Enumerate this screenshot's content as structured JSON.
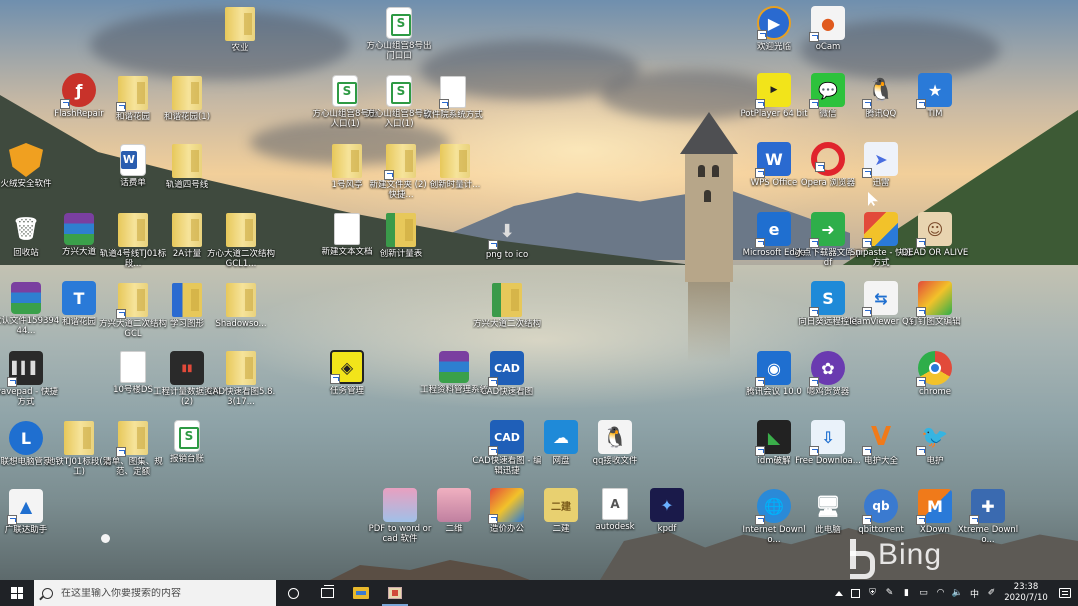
{
  "desktop": {
    "icons": {
      "i01": {
        "label": "农业"
      },
      "i02": {
        "label": "方心山组宫8号出门口口"
      },
      "i03": {
        "label": "欢迎光临"
      },
      "i04": {
        "label": "oCam"
      },
      "i05": {
        "label": "FlashRepair"
      },
      "i06": {
        "label": "和谐花园"
      },
      "i07": {
        "label": "和谐花园(1)"
      },
      "i08": {
        "label": "方心山组宫8号出人口(1)"
      },
      "i09": {
        "label": "方心山组宫8号出入口(1)"
      },
      "i10": {
        "label": "软件院系统方式"
      },
      "i11": {
        "label": "PotPlayer 64 bit"
      },
      "i12": {
        "label": "微信"
      },
      "i13": {
        "label": "腾讯QQ"
      },
      "i14": {
        "label": "TIM"
      },
      "i15": {
        "label": "火绒安全软件"
      },
      "i16": {
        "label": "话费单"
      },
      "i17": {
        "label": "轨道四号线"
      },
      "i18": {
        "label": "1号风亭"
      },
      "i19": {
        "label": "新建文件夹 (2) - 快捷..."
      },
      "i20": {
        "label": "创新时量计..."
      },
      "i21": {
        "label": "WPS Office"
      },
      "i22": {
        "label": "Opera 浏览器"
      },
      "i23": {
        "label": "迅雷"
      },
      "i24": {
        "label": "回收站"
      },
      "i25": {
        "label": "方兴大道"
      },
      "i26": {
        "label": "轨道4号线TJ01标段..."
      },
      "i27": {
        "label": "2A计量"
      },
      "i28": {
        "label": "方心大道二次结构GCL1..."
      },
      "i29": {
        "label": "新建文本文档"
      },
      "i30": {
        "label": "创新计量表"
      },
      "i31": {
        "label": "png to ico"
      },
      "i32": {
        "label": "Microsoft Edge"
      },
      "i33": {
        "label": "冰点下载器文库.pdf"
      },
      "i34": {
        "label": "Snipaste - 快捷方式"
      },
      "i35": {
        "label": "DEAD OR ALIVE"
      },
      "i36": {
        "label": "默认文件15939444..."
      },
      "i37": {
        "label": "和谐花园"
      },
      "i38": {
        "label": "方兴大道二次结构GCL"
      },
      "i39": {
        "label": "学习图形"
      },
      "i40": {
        "label": "Shadowso..."
      },
      "i41": {
        "label": "方兴大道二次结构"
      },
      "i42": {
        "label": "向日葵远程控制"
      },
      "i43": {
        "label": "TeamViewer QS"
      },
      "i44": {
        "label": "钉钉图文编辑"
      },
      "i45": {
        "label": "wavepad - 快捷方式"
      },
      "i46": {
        "label": "10号楼DS"
      },
      "i47": {
        "label": "工程计量数据资料(2)"
      },
      "i48": {
        "label": "CAD快速看图5.8.3(17..."
      },
      "i49": {
        "label": "任务管理"
      },
      "i50": {
        "label": "工程资料管理系统"
      },
      "i51": {
        "label": "CAD快速看图"
      },
      "i52": {
        "label": "腾讯会议 10.0"
      },
      "i53": {
        "label": "嗯鸡贺贺器"
      },
      "i54": {
        "label": "chrome"
      },
      "i55": {
        "label": "联想电脑管家"
      },
      "i56": {
        "label": "地铁TJ01标段(完工)"
      },
      "i57": {
        "label": "清单、图集、规范、定额"
      },
      "i58": {
        "label": "报销台账"
      },
      "i59": {
        "label": "CAD快速看图 - 编辑迅捷"
      },
      "i60": {
        "label": "网盘"
      },
      "i61": {
        "label": "qq接收文件"
      },
      "i62": {
        "label": "idm破解"
      },
      "i63": {
        "label": "Free Downloa..."
      },
      "i64": {
        "label": "电护大全"
      },
      "i65": {
        "label": "电护"
      },
      "i66": {
        "label": "广联达助手"
      },
      "i67": {
        "label": "PDF to word or cad 软件"
      },
      "i68": {
        "label": "二维"
      },
      "i69": {
        "label": "造价办公"
      },
      "i70": {
        "label": "二建"
      },
      "i71": {
        "label": "autodesk"
      },
      "i72": {
        "label": "kpdf"
      },
      "i73": {
        "label": "Internet Downlo..."
      },
      "i74": {
        "label": "此电脑"
      },
      "i75": {
        "label": "qbittorrent"
      },
      "i76": {
        "label": "XDown"
      },
      "i77": {
        "label": "Xtreme Downlo..."
      }
    },
    "watermark": "Bing"
  },
  "taskbar": {
    "search_placeholder": "在这里输入你要搜索的内容",
    "tray_ime": "中",
    "clock_time": "23:38",
    "clock_date": "2020/7/10"
  }
}
